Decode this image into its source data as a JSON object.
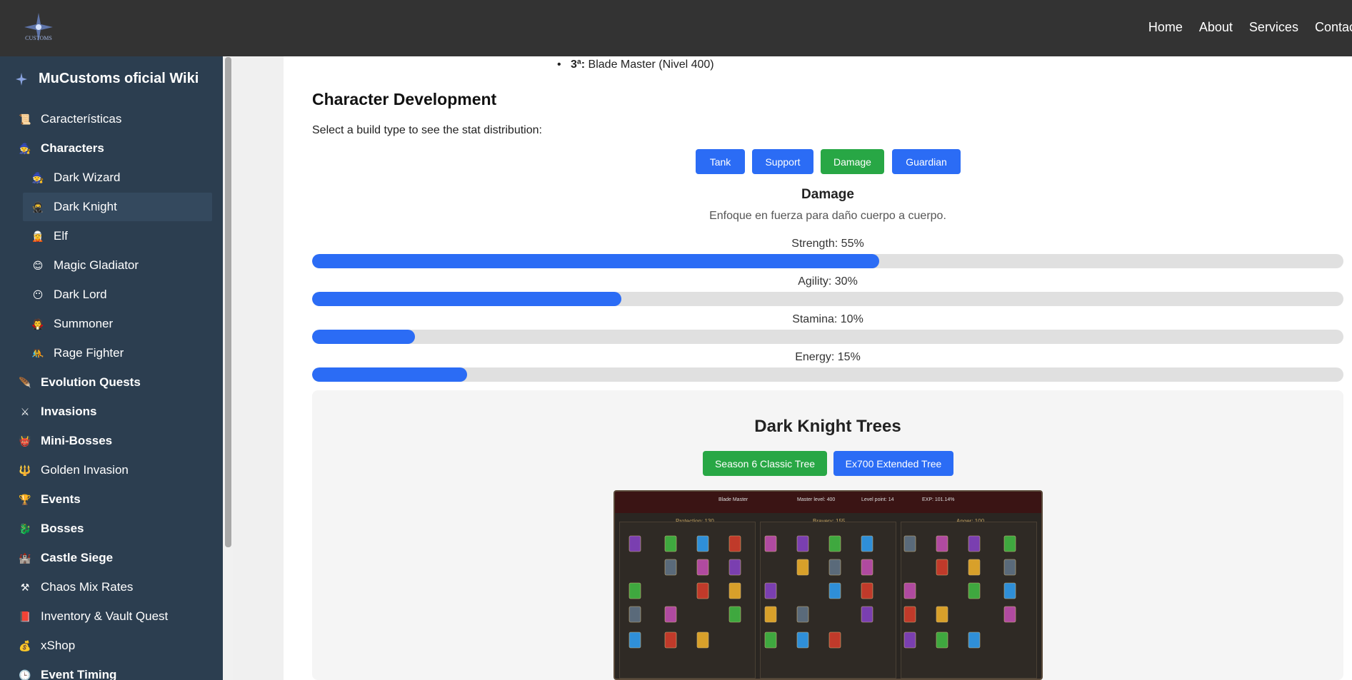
{
  "topnav": [
    "Home",
    "About",
    "Services",
    "Contact"
  ],
  "sidebar": {
    "title": "MuCustoms oficial Wiki",
    "items": [
      {
        "label": "Características",
        "icon": "scroll-icon",
        "glyph": "📜",
        "bold": false
      },
      {
        "label": "Characters",
        "icon": "character-icon",
        "glyph": "🧙",
        "bold": true
      },
      {
        "label": "Dark Wizard",
        "icon": "wizard-icon",
        "glyph": "🧙",
        "bold": false,
        "sub": true
      },
      {
        "label": "Dark Knight",
        "icon": "knight-icon",
        "glyph": "🥷",
        "bold": false,
        "sub": true,
        "active": true
      },
      {
        "label": "Elf",
        "icon": "elf-icon",
        "glyph": "🧝",
        "bold": false,
        "sub": true
      },
      {
        "label": "Magic Gladiator",
        "icon": "gladiator-icon",
        "glyph": "😊",
        "bold": false,
        "sub": true
      },
      {
        "label": "Dark Lord",
        "icon": "dark-lord-icon",
        "glyph": "😶",
        "bold": false,
        "sub": true
      },
      {
        "label": "Summoner",
        "icon": "summoner-icon",
        "glyph": "🧛",
        "bold": false,
        "sub": true
      },
      {
        "label": "Rage Fighter",
        "icon": "fighter-icon",
        "glyph": "🤼",
        "bold": false,
        "sub": true
      },
      {
        "label": "Evolution Quests",
        "icon": "feather-icon",
        "glyph": "🪶",
        "bold": true
      },
      {
        "label": "Invasions",
        "icon": "swords-icon",
        "glyph": "⚔",
        "bold": true
      },
      {
        "label": "Mini-Bosses",
        "icon": "demon-icon",
        "glyph": "👹",
        "bold": true
      },
      {
        "label": "Golden Invasion",
        "icon": "trident-icon",
        "glyph": "🔱",
        "bold": false
      },
      {
        "label": "Events",
        "icon": "trophy-icon",
        "glyph": "🏆",
        "bold": true
      },
      {
        "label": "Bosses",
        "icon": "dragon-icon",
        "glyph": "🐉",
        "bold": true
      },
      {
        "label": "Castle Siege",
        "icon": "castle-icon",
        "glyph": "🏰",
        "bold": true
      },
      {
        "label": "Chaos Mix Rates",
        "icon": "tools-icon",
        "glyph": "⚒",
        "bold": false
      },
      {
        "label": "Inventory & Vault Quest",
        "icon": "book-icon",
        "glyph": "📕",
        "bold": false
      },
      {
        "label": "xShop",
        "icon": "money-bag-icon",
        "glyph": "💰",
        "bold": false
      },
      {
        "label": "Event Timing",
        "icon": "clock-icon",
        "glyph": "🕒",
        "bold": true
      }
    ]
  },
  "main": {
    "evolution_prefix": "3ª:",
    "evolution_text": "Blade Master (Nivel 400)",
    "dev_title": "Character Development",
    "instruction": "Select a build type to see the stat distribution:",
    "builds": [
      {
        "label": "Tank",
        "color": "#2b6cf5"
      },
      {
        "label": "Support",
        "color": "#2b6cf5"
      },
      {
        "label": "Damage",
        "color": "#28a745"
      },
      {
        "label": "Guardian",
        "color": "#2b6cf5"
      }
    ],
    "selected_build": {
      "title": "Damage",
      "description": "Enfoque en fuerza para daño cuerpo a cuerpo.",
      "stats": [
        {
          "label": "Strength: 55%",
          "value": 55
        },
        {
          "label": "Agility: 30%",
          "value": 30
        },
        {
          "label": "Stamina: 10%",
          "value": 10
        },
        {
          "label": "Energy: 15%",
          "value": 15
        }
      ]
    },
    "trees": {
      "title": "Dark Knight Trees",
      "buttons": [
        {
          "label": "Season 6 Classic Tree",
          "color": "#28a745"
        },
        {
          "label": "Ex700 Extended Tree",
          "color": "#2b6cf5"
        }
      ],
      "game_header": [
        "Blade Master",
        "Master level: 400",
        "Level point: 14",
        "EXP: 101.14%"
      ],
      "game_columns": [
        "Protection: 130",
        "Bravery: 155",
        "Anger: 100"
      ]
    }
  },
  "colors": {
    "primary": "#2b6cf5",
    "success": "#28a745",
    "sidebar": "#2c3e50",
    "topbar": "#333333"
  }
}
